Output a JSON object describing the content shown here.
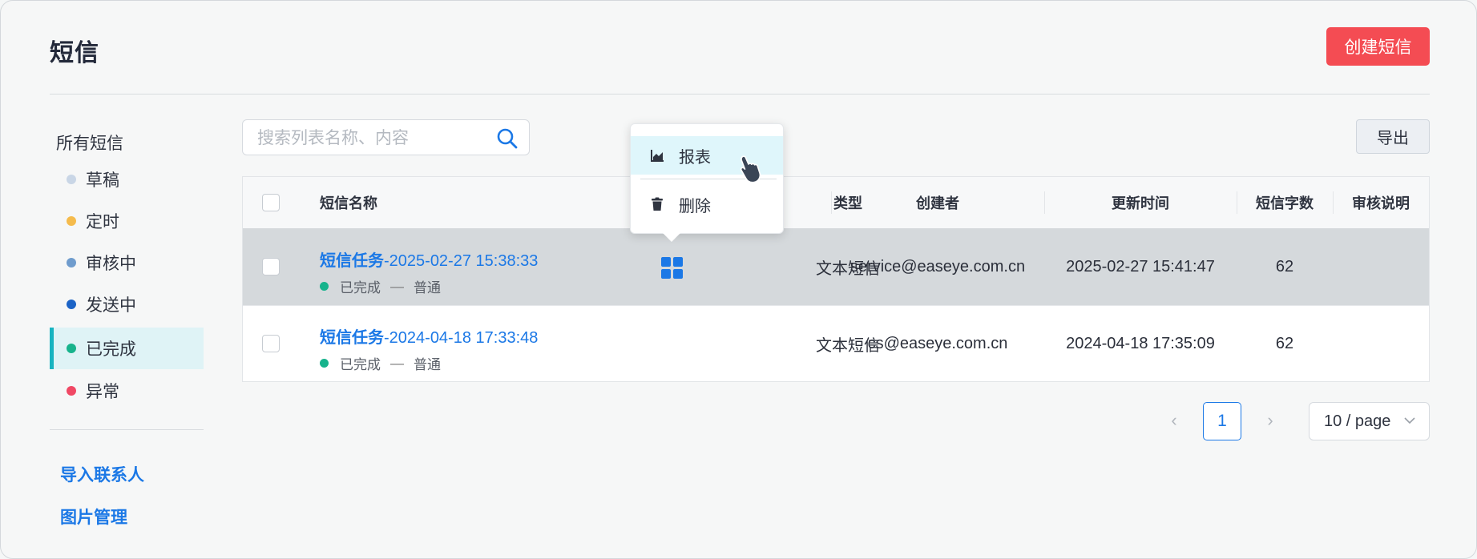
{
  "header": {
    "title": "短信",
    "create_label": "创建短信"
  },
  "sidebar": {
    "heading": "所有短信",
    "items": [
      {
        "label": "草稿",
        "color": "#c9d6e6"
      },
      {
        "label": "定时",
        "color": "#f5bb4c"
      },
      {
        "label": "审核中",
        "color": "#6f9ccd"
      },
      {
        "label": "发送中",
        "color": "#1b63c6"
      },
      {
        "label": "已完成",
        "color": "#17b38c",
        "active": true
      },
      {
        "label": "异常",
        "color": "#f04864"
      }
    ],
    "links": [
      "导入联系人",
      "图片管理"
    ]
  },
  "toolbar": {
    "search_placeholder": "搜索列表名称、内容",
    "export_label": "导出"
  },
  "table": {
    "columns": [
      "短信名称",
      "类型",
      "创建者",
      "更新时间",
      "短信字数",
      "审核说明"
    ],
    "rows": [
      {
        "name": "短信任务-2025-02-27 15:38:33",
        "status": "已完成",
        "priority": "普通",
        "type": "文本短信",
        "creator": "service@easeye.com.cn",
        "updated": "2025-02-27 15:41:47",
        "chars": "62",
        "review": ""
      },
      {
        "name": "短信任务-2024-04-18 17:33:48",
        "status": "已完成",
        "priority": "普通",
        "type": "文本短信",
        "creator": "cs@easeye.com.cn",
        "updated": "2024-04-18 17:35:09",
        "chars": "62",
        "review": ""
      }
    ],
    "status_separator": "—",
    "status_color": "#17b38c"
  },
  "dropdown": {
    "items": [
      {
        "label": "报表",
        "icon": "chart-icon"
      },
      {
        "label": "删除",
        "icon": "trash-icon"
      }
    ]
  },
  "pagination": {
    "prev": "‹",
    "next": "›",
    "current": "1",
    "page_size": "10 / page"
  },
  "colors": {
    "accent": "#1b78e6",
    "danger": "#f44c53",
    "active_bg": "#dff3f6"
  }
}
